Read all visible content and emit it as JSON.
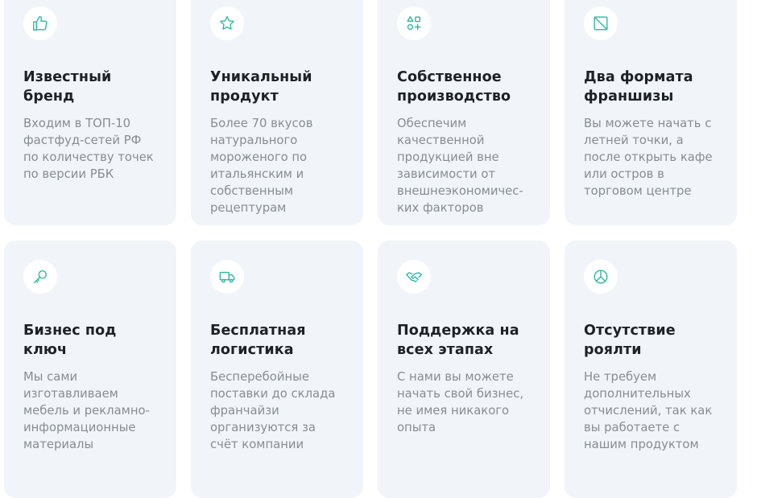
{
  "colors": {
    "accent": "#2bb8a3",
    "card_bg": "#f1f5f9",
    "title": "#1d2226",
    "text": "#868d93"
  },
  "cards": [
    {
      "icon": "thumbs-up-icon",
      "title": "Известный\nбренд",
      "description": "Входим в ТОП-10\nфастфуд-сетей РФ\nпо количеству точек\nпо версии РБК"
    },
    {
      "icon": "star-icon",
      "title": "Уникальный\nпродукт",
      "description": "Более 70 вкусов\nнатурального\nмороженого по\nитальянским и\nсобственным\nрецептурам"
    },
    {
      "icon": "shapes-icon",
      "title": "Собственное\nпроизводство",
      "description": "Обеспечим\nкачественной\nпродукцией вне\nзависимости от\nвнешнеэкономичес-\nких факторов"
    },
    {
      "icon": "square-slash-icon",
      "title": "Два формата\nфраншизы",
      "description": "Вы можете начать с\nлетней точки, а\nпосле открыть кафе\nили остров в\nторговом центре"
    },
    {
      "icon": "key-icon",
      "title": "Бизнес под\nключ",
      "description": "Мы сами\nизготавливаем\nмебель и рекламно-\nинформационные\nматериалы"
    },
    {
      "icon": "truck-icon",
      "title": "Бесплатная\nлогистика",
      "description": "Бесперебойные\nпоставки до склада\nфранчайзи\nорганизуются за\nсчёт компании"
    },
    {
      "icon": "handshake-icon",
      "title": "Поддержка на\nвсех этапах",
      "description": "С нами вы можете\nначать свой бизнес,\nне имея никакого\nопыта"
    },
    {
      "icon": "pie-chart-icon",
      "title": "Отсутствие\nроялти",
      "description": "Не требуем\nдополнительных\nотчислений, так как\nвы работаете с\nнашим продуктом"
    }
  ]
}
